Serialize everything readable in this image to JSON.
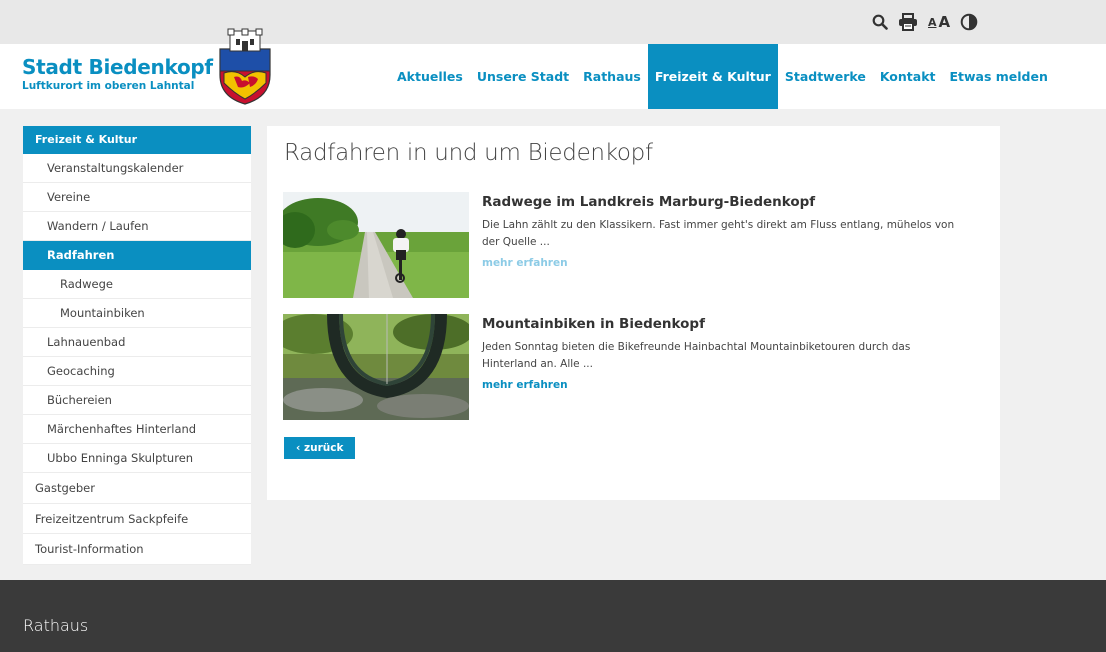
{
  "toolbar": {
    "search_icon": "search-icon",
    "print_icon": "print-icon",
    "font_small": "A",
    "font_large": "A",
    "contrast_icon": "contrast-icon"
  },
  "brand": {
    "title": "Stadt Biedenkopf",
    "subtitle": "Luftkurort im oberen Lahntal"
  },
  "nav": {
    "items": [
      {
        "label": "Aktuelles"
      },
      {
        "label": "Unsere Stadt"
      },
      {
        "label": "Rathaus"
      },
      {
        "label": "Freizeit & Kultur"
      },
      {
        "label": "Stadtwerke"
      },
      {
        "label": "Kontakt"
      },
      {
        "label": "Etwas melden"
      }
    ],
    "active": "Freizeit & Kultur"
  },
  "sidebar": {
    "heading": "Freizeit & Kultur",
    "items": [
      {
        "label": "Veranstaltungskalender"
      },
      {
        "label": "Vereine"
      },
      {
        "label": "Wandern / Laufen"
      },
      {
        "label": "Radfahren"
      },
      {
        "label": "Radwege"
      },
      {
        "label": "Mountainbiken"
      },
      {
        "label": "Lahnauenbad"
      },
      {
        "label": "Geocaching"
      },
      {
        "label": "Büchereien"
      },
      {
        "label": "Märchenhaftes Hinterland"
      },
      {
        "label": "Ubbo Enninga Skulpturen"
      },
      {
        "label": "Gastgeber"
      },
      {
        "label": "Freizeitzentrum Sackpfeife"
      },
      {
        "label": "Tourist-Information"
      }
    ]
  },
  "main": {
    "title": "Radfahren in und um Biedenkopf",
    "teasers": [
      {
        "heading": "Radwege im Landkreis Marburg-Biedenkopf",
        "line1": "Die Lahn zählt zu den Klassikern. Fast immer geht's direkt am Fluss entlang, mühelos von",
        "line2": "der Quelle ...",
        "more": "mehr erfahren"
      },
      {
        "heading": "Mountainbiken in Biedenkopf",
        "line1": "Jeden Sonntag bieten die Bikefreunde Hainbachtal Mountainbiketouren durch das",
        "line2": "Hinterland an. Alle ...",
        "more": "mehr erfahren"
      }
    ],
    "back_label": "zurück"
  },
  "footer": {
    "title": "Rathaus"
  },
  "colors": {
    "accent": "#0a8fc1",
    "footer": "#3a3a3a"
  }
}
